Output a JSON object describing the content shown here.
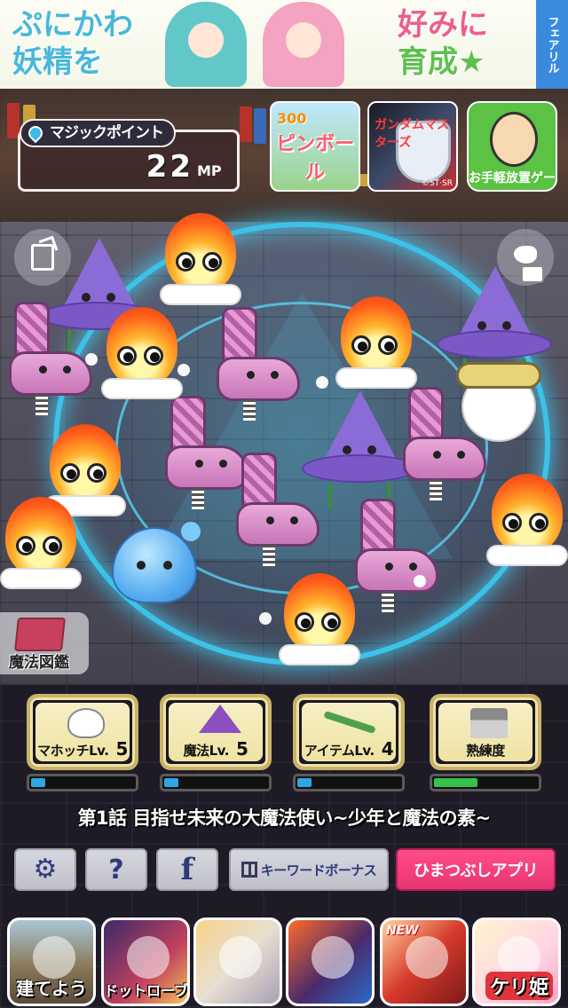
{
  "ad_banner": {
    "left_line1": "ぷにかわ",
    "left_line2": "妖精を",
    "right_line1": "好みに",
    "right_line2": "育成★",
    "side_tag": "フェアリル"
  },
  "mp_panel": {
    "label": "マジックポイント",
    "value": "22",
    "unit": "MP"
  },
  "top_apps": {
    "pinball": {
      "score": "300",
      "label": "ピンボール"
    },
    "gundam": {
      "label": "ガンダムマスターズ",
      "copyright": "©ST·SR"
    },
    "idle": {
      "label": "お手軽放置ゲー"
    }
  },
  "encyclopedia": {
    "label": "魔法図鑑"
  },
  "stats": [
    {
      "label": "マホッチLv.",
      "value": "5",
      "progress": 0.14,
      "bar_color": "#2ea6e6"
    },
    {
      "label": "魔法Lv.",
      "value": "5",
      "progress": 0.14,
      "bar_color": "#2ea6e6"
    },
    {
      "label": "アイテムLv.",
      "value": "4",
      "progress": 0.14,
      "bar_color": "#2ea6e6"
    },
    {
      "label": "熟練度",
      "value": "",
      "progress": 0.42,
      "bar_color": "#34c24a"
    }
  ],
  "chapter_title": "第1話 目指せ未来の大魔法使い~少年と魔法の素~",
  "toolbar": {
    "keyword_bonus_label": "キーワードボーナス",
    "himatsubushi_label": "ひまつぶしアプリ"
  },
  "promo_apps": {
    "tateyou": "建てよう",
    "dotto": "ドットローブレ!",
    "oni_badge": "NEW",
    "keri": "ケリ姫"
  },
  "icons": {
    "share": "share-icon",
    "twitter": "twitter-icon",
    "camera": "camera-icon",
    "settings": "gear-icon",
    "help": "question-icon",
    "facebook": "facebook-icon",
    "gift": "gift-icon"
  }
}
